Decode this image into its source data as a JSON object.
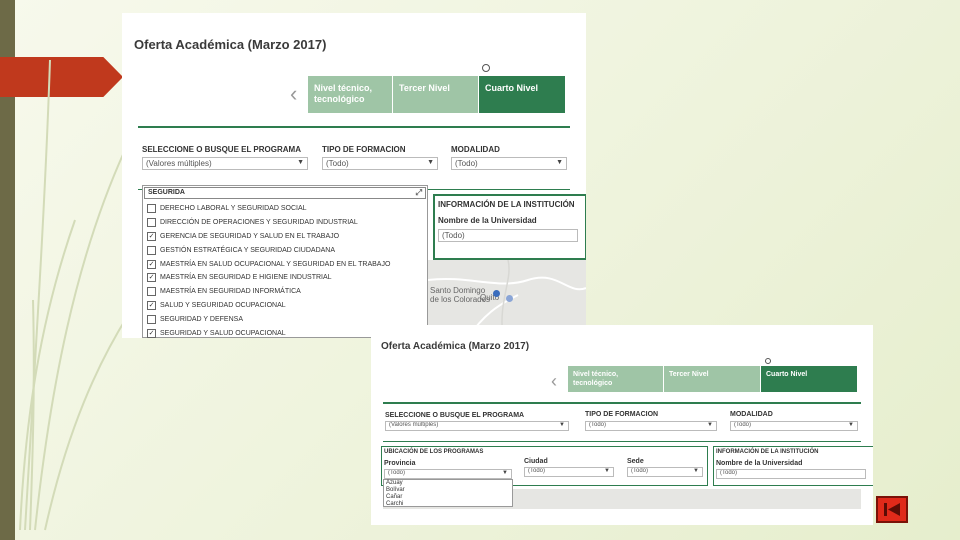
{
  "slide": {
    "nav_button_icon": "skip-back-icon",
    "accent": "#c0391d",
    "brand_green": "#2e7d4f"
  },
  "shot1": {
    "title": "Oferta Académica (Marzo 2017)",
    "tabs": [
      "Nivel técnico, tecnológico",
      "Tercer Nivel",
      "Cuarto Nivel"
    ],
    "filters": {
      "programa_label": "SELECCIONE O BUSQUE EL PROGRAMA",
      "programa_value": "(Valores múltiples)",
      "tipo_label": "TIPO DE FORMACION",
      "tipo_value": "(Todo)",
      "modalidad_label": "MODALIDAD",
      "modalidad_value": "(Todo)"
    },
    "dropdown": {
      "search_value": "SEGURIDA",
      "options": [
        {
          "label": "DERECHO LABORAL Y SEGURIDAD SOCIAL",
          "checked": false
        },
        {
          "label": "DIRECCIÓN DE OPERACIONES Y SEGURIDAD INDUSTRIAL",
          "checked": false
        },
        {
          "label": "GERENCIA DE SEGURIDAD Y SALUD EN EL TRABAJO",
          "checked": true
        },
        {
          "label": "GESTIÓN ESTRATÉGICA Y SEGURIDAD CIUDADANA",
          "checked": false
        },
        {
          "label": "MAESTRÍA EN SALUD OCUPACIONAL Y SEGURIDAD EN EL TRABAJO",
          "checked": true
        },
        {
          "label": "MAESTRÍA EN SEGURIDAD E HIGIENE INDUSTRIAL",
          "checked": true
        },
        {
          "label": "MAESTRÍA EN SEGURIDAD INFORMÁTICA",
          "checked": false
        },
        {
          "label": "SALUD Y SEGURIDAD OCUPACIONAL",
          "checked": true
        },
        {
          "label": "SEGURIDAD Y DEFENSA",
          "checked": false
        },
        {
          "label": "SEGURIDAD Y SALUD OCUPACIONAL",
          "checked": true
        }
      ]
    },
    "info": {
      "heading": "INFORMACIÓN DE LA INSTITUCIÓN",
      "name_label": "Nombre de la Universidad",
      "name_value": "(Todo)"
    },
    "map": {
      "label1": "Santo Domingo",
      "label2": "de los Colorados",
      "label3": "Quito"
    }
  },
  "shot2": {
    "title": "Oferta Académica (Marzo 2017)",
    "tabs": [
      "Nivel técnico, tecnológico",
      "Tercer Nivel",
      "Cuarto Nivel"
    ],
    "filters": {
      "programa_label": "SELECCIONE O BUSQUE EL PROGRAMA",
      "programa_value": "(Valores múltiples)",
      "tipo_label": "TIPO DE FORMACION",
      "tipo_value": "(Todo)",
      "modalidad_label": "MODALIDAD",
      "modalidad_value": "(Todo)"
    },
    "location": {
      "heading": "UBICACIÓN DE LOS PROGRAMAS",
      "provincia_label": "Provincia",
      "provincia_value": "(Todo)",
      "ciudad_label": "Ciudad",
      "ciudad_value": "(Todo)",
      "sede_label": "Sede",
      "sede_value": "(Todo)",
      "list": [
        "Azuay",
        "Bolívar",
        "Cañar",
        "Carchi"
      ]
    },
    "info": {
      "heading": "INFORMACIÓN DE LA INSTITUCIÓN",
      "name_label": "Nombre de la Universidad",
      "name_value": "(Todo)"
    }
  }
}
